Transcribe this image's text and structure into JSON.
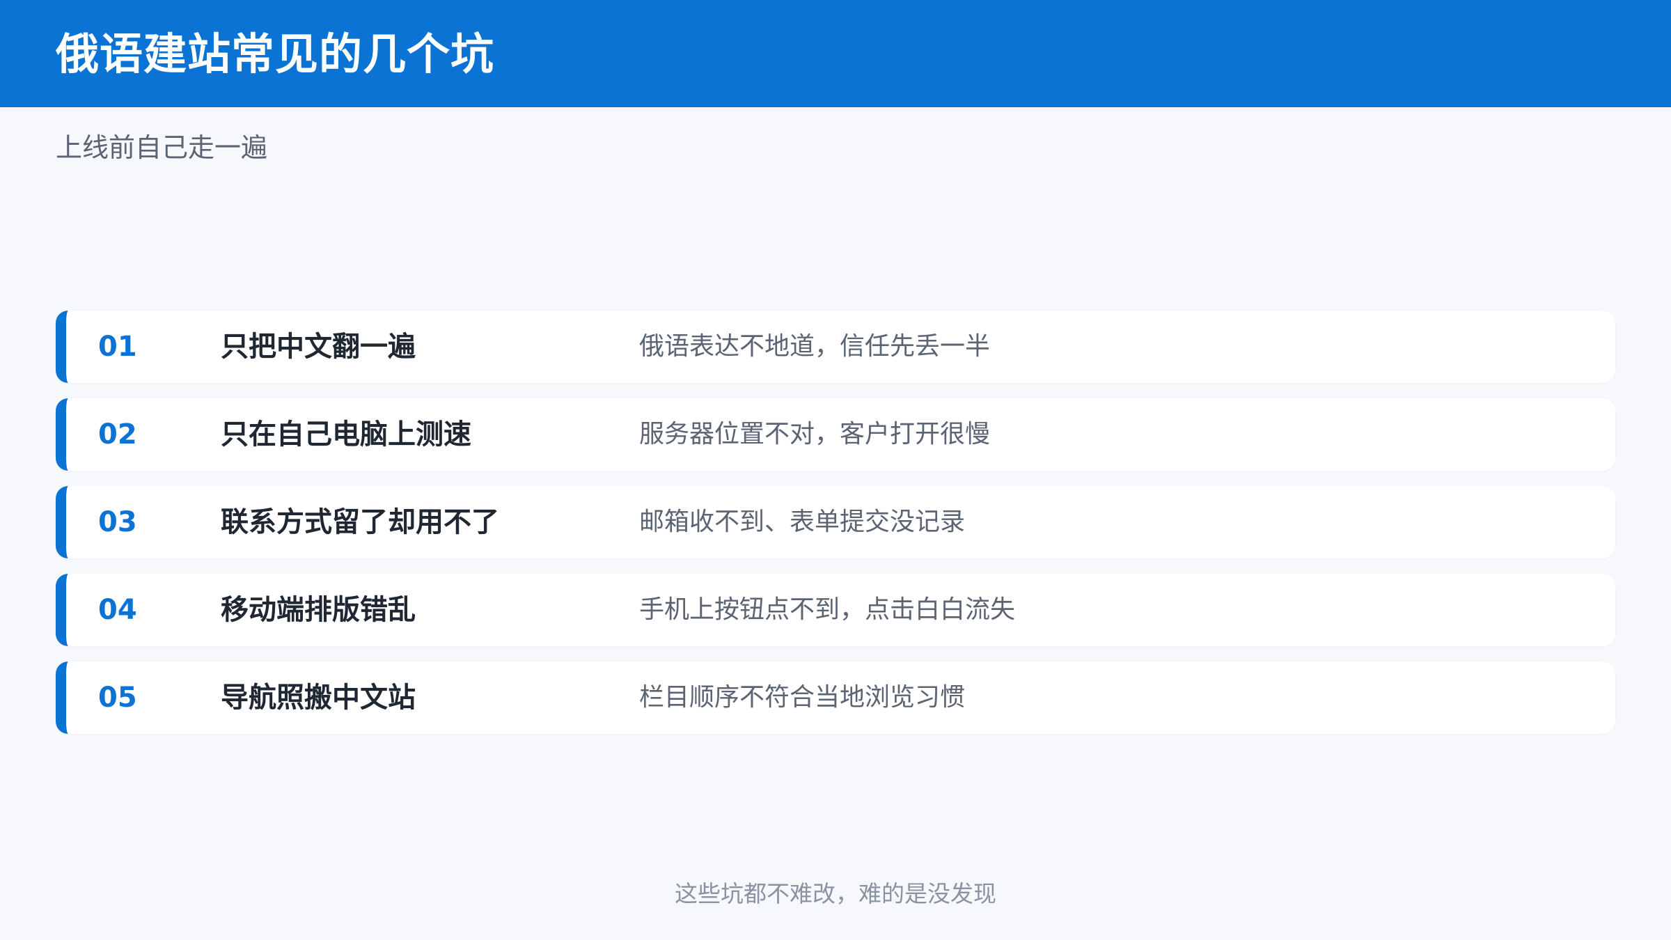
{
  "slide": {
    "title": "俄语建站常见的几个坑",
    "subtitle": "上线前自己走一遍",
    "items": [
      {
        "num": "01",
        "pit": "只把中文翻一遍",
        "desc": "俄语表达不地道，信任先丢一半"
      },
      {
        "num": "02",
        "pit": "只在自己电脑上测速",
        "desc": "服务器位置不对，客户打开很慢"
      },
      {
        "num": "03",
        "pit": "联系方式留了却用不了",
        "desc": "邮箱收不到、表单提交没记录"
      },
      {
        "num": "04",
        "pit": "移动端排版错乱",
        "desc": "手机上按钮点不到，点击白白流失"
      },
      {
        "num": "05",
        "pit": "导航照搬中文站",
        "desc": "栏目顺序不符合当地浏览习惯"
      }
    ],
    "footer": "这些坑都不难改，难的是没发现"
  },
  "colors": {
    "accent": "#0B73D3",
    "background": "#F6F8FC",
    "card": "#FFFFFF",
    "heading_text": "#1F2733",
    "body_text": "#5B6473",
    "muted_text": "#8A93A1"
  }
}
